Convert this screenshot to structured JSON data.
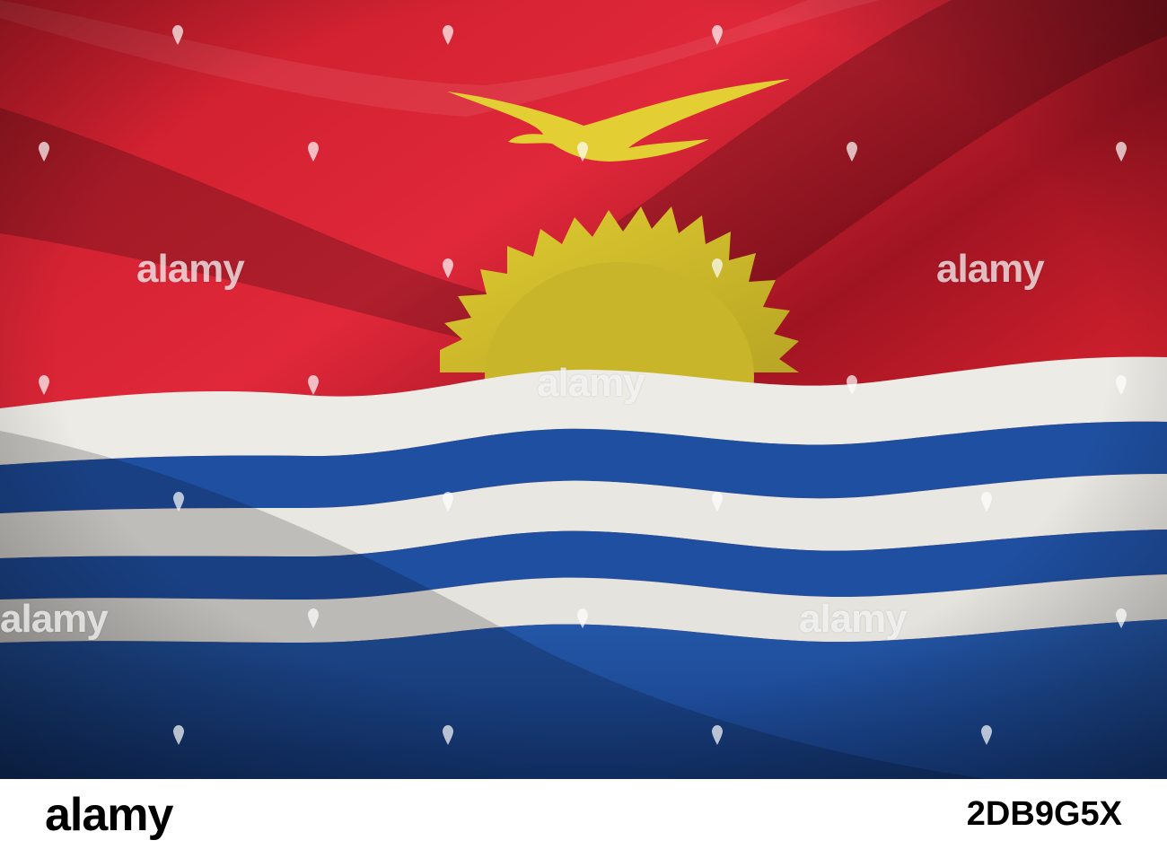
{
  "photo": {
    "subject": "",
    "colors": {
      "red": "#d8222f",
      "yellow": "#d9c42a",
      "white": "#e8e8e4",
      "blue": "#1f4fa0",
      "footer_bg": "#ffffff"
    }
  },
  "watermark": {
    "text": "alamy"
  },
  "footer": {
    "logo_text": "alamy",
    "image_id": "2DB9G5X"
  }
}
